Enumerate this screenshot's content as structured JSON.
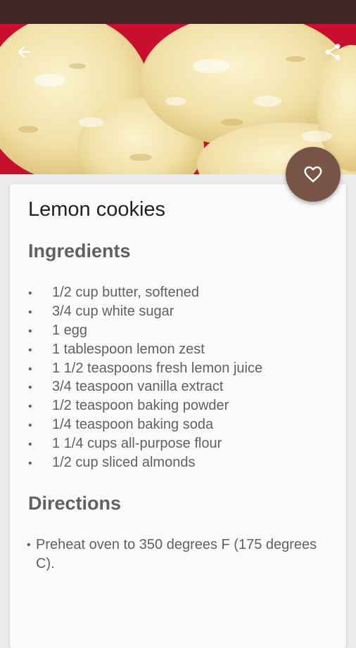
{
  "header": {
    "back_icon": "arrow-left-icon",
    "share_icon": "share-icon"
  },
  "hero": {
    "image": "lemon-cookies-photo"
  },
  "favorite": {
    "icon": "heart-outline-icon",
    "color": "#795548"
  },
  "recipe": {
    "title": "Lemon cookies",
    "ingredients_heading": "Ingredients",
    "ingredients": [
      "1/2 cup butter, softened",
      "3/4 cup white sugar",
      "1 egg",
      "1 tablespoon lemon zest",
      "1 1/2 teaspoons fresh lemon juice",
      "3/4 teaspoon vanilla extract",
      "1/2 teaspoon baking powder",
      "1/4 teaspoon baking soda",
      "1 1/4 cups all-purpose flour",
      "1/2 cup sliced almonds"
    ],
    "directions_heading": "Directions",
    "directions": [
      "Preheat oven to 350 degrees F (175 degrees C)."
    ]
  },
  "colors": {
    "status_bar": "#3e2723",
    "accent": "#795548",
    "heading_text": "#616161"
  }
}
